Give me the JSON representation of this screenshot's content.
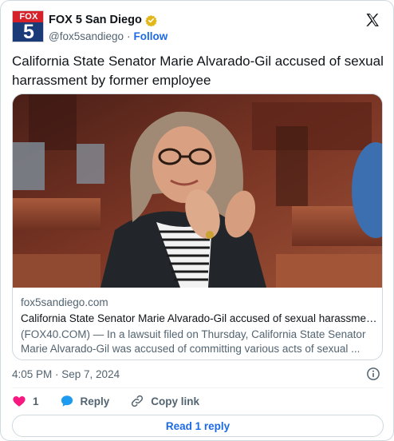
{
  "author": {
    "display_name": "FOX 5 San Diego",
    "handle": "@fox5sandiego",
    "follow_label": "Follow",
    "avatar": {
      "top_text": "FOX",
      "number": "5"
    }
  },
  "tweet": {
    "text": "California State Senator Marie Alvarado-Gil accused of sexual harrassment by former employee"
  },
  "link_card": {
    "domain": "fox5sandiego.com",
    "title": "California State Senator Marie Alvarado-Gil accused of sexual harassment...",
    "description": "(FOX40.COM) — In a lawsuit filed on Thursday, California State Senator Marie Alvarado-Gil was accused of committing various acts of sexual ..."
  },
  "timestamp": "4:05 PM · Sep 7, 2024",
  "actions": {
    "like_count": "1",
    "reply_label": "Reply",
    "copy_link_label": "Copy link"
  },
  "read_reply_label": "Read 1 reply",
  "colors": {
    "accent": "#1d6ae5",
    "like": "#f91880",
    "verified": "#e2b719",
    "fox_red": "#d6202a",
    "fox_blue": "#1a3a78"
  }
}
